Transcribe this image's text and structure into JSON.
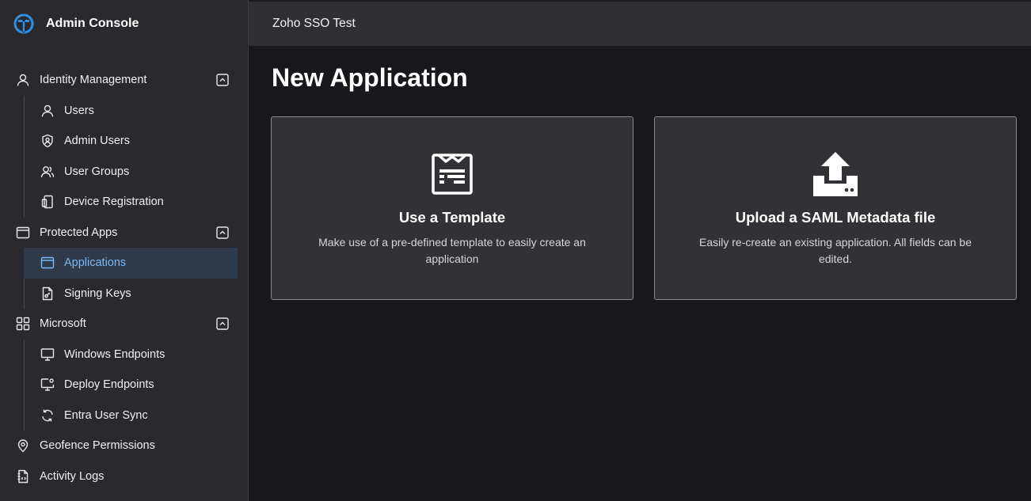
{
  "app": {
    "title": "Admin Console",
    "brand_color": "#2f8fe0"
  },
  "sidebar": {
    "items": [
      {
        "label": "Identity Management",
        "icon": "user-icon",
        "level": "top",
        "collapsible": true
      },
      {
        "label": "Users",
        "icon": "user-icon",
        "level": "sub"
      },
      {
        "label": "Admin Users",
        "icon": "shield-user-icon",
        "level": "sub"
      },
      {
        "label": "User Groups",
        "icon": "user-group-icon",
        "level": "sub"
      },
      {
        "label": "Device Registration",
        "icon": "device-icon",
        "level": "sub"
      },
      {
        "label": "Protected Apps",
        "icon": "window-icon",
        "level": "top",
        "collapsible": true
      },
      {
        "label": "Applications",
        "icon": "window-icon",
        "level": "sub",
        "active": true
      },
      {
        "label": "Signing Keys",
        "icon": "key-document-icon",
        "level": "sub"
      },
      {
        "label": "Microsoft",
        "icon": "grid-icon",
        "level": "top",
        "collapsible": true
      },
      {
        "label": "Windows Endpoints",
        "icon": "monitor-icon",
        "level": "sub"
      },
      {
        "label": "Deploy Endpoints",
        "icon": "monitor-gear-icon",
        "level": "sub"
      },
      {
        "label": "Entra User Sync",
        "icon": "sync-icon",
        "level": "sub"
      },
      {
        "label": "Geofence Permissions",
        "icon": "location-pin-icon",
        "level": "top"
      },
      {
        "label": "Activity Logs",
        "icon": "log-document-icon",
        "level": "top"
      }
    ],
    "active_color": "#7cb8f5"
  },
  "topbar": {
    "title": "Zoho SSO Test"
  },
  "main": {
    "page_title": "New Application",
    "cards": [
      {
        "icon": "template-icon",
        "title": "Use a Template",
        "description": "Make use of a pre-defined template to easily create an application"
      },
      {
        "icon": "upload-icon",
        "title": "Upload a SAML Metadata file",
        "description": "Easily re-create an existing application. All fields can be edited."
      }
    ]
  }
}
